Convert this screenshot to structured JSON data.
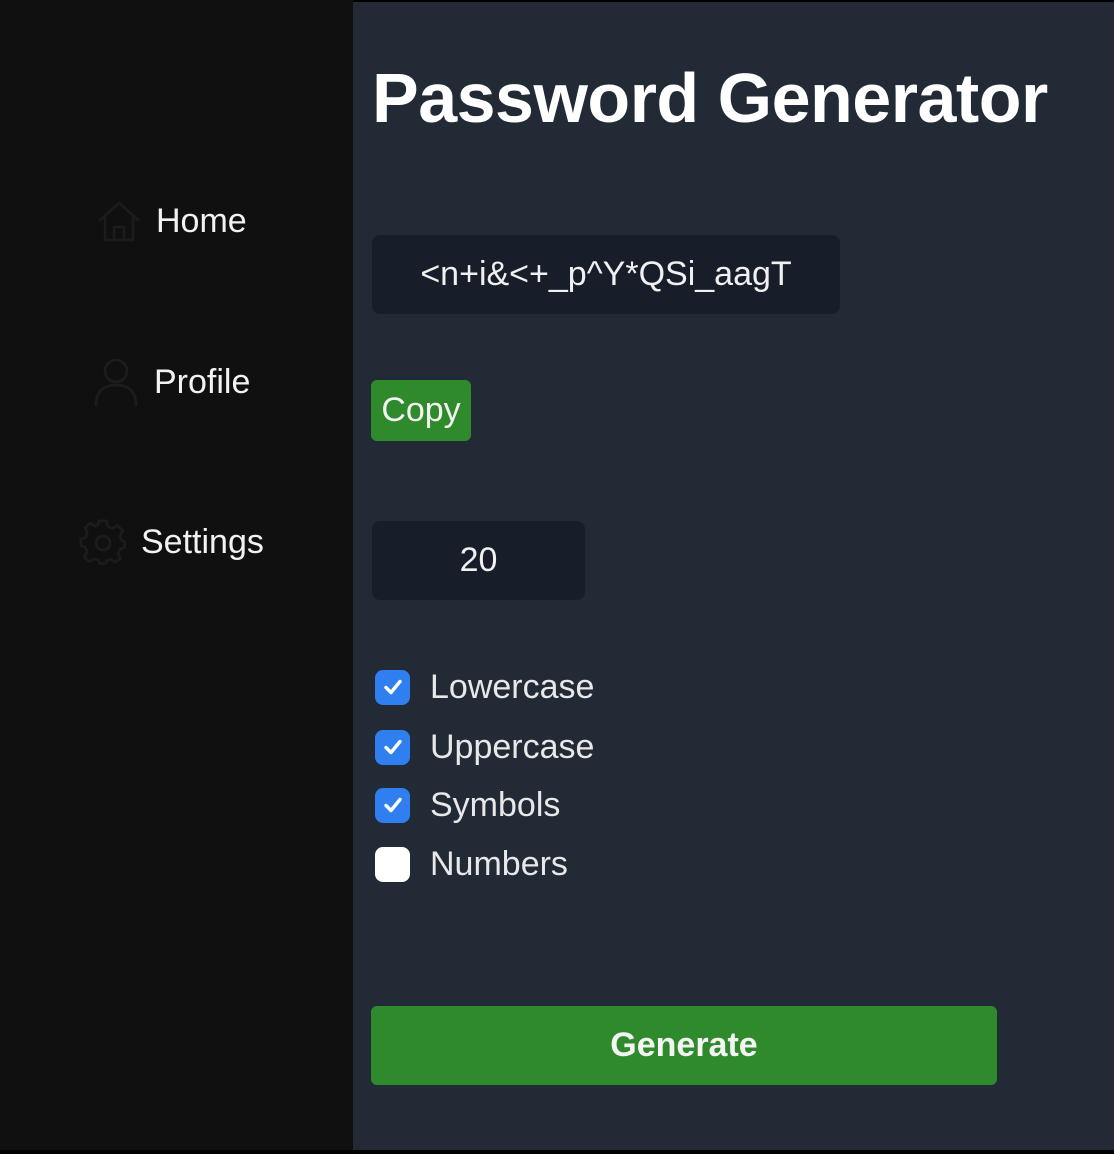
{
  "sidebar": {
    "items": [
      {
        "label": "Home",
        "icon": "home-icon"
      },
      {
        "label": "Profile",
        "icon": "user-icon"
      },
      {
        "label": "Settings",
        "icon": "gear-icon"
      }
    ]
  },
  "main": {
    "title": "Password Generator",
    "password_value": "<n+i&<+_p^Y*QSi_aagT",
    "copy_label": "Copy",
    "length_value": "20",
    "options": [
      {
        "label": "Lowercase",
        "checked": true
      },
      {
        "label": "Uppercase",
        "checked": true
      },
      {
        "label": "Symbols",
        "checked": true
      },
      {
        "label": "Numbers",
        "checked": false
      }
    ],
    "generate_label": "Generate"
  },
  "colors": {
    "sidebar_bg": "#101010",
    "main_bg": "#222a36",
    "field_bg": "#181e29",
    "accent_green": "#2f8a2b",
    "checkbox_blue": "#2f7ff0"
  }
}
